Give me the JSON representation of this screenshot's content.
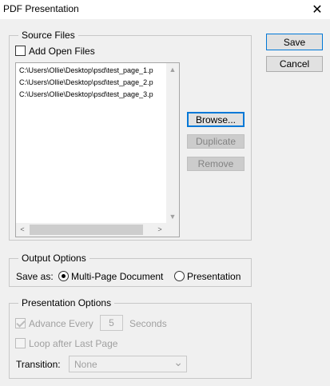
{
  "window": {
    "title": "PDF Presentation",
    "close_glyph": "✕"
  },
  "source_files": {
    "legend": "Source Files",
    "add_open_files_label": "Add Open Files",
    "files": [
      "C:\\Users\\Ollie\\Desktop\\psd\\test_page_1.p",
      "C:\\Users\\Ollie\\Desktop\\psd\\test_page_2.p",
      "C:\\Users\\Ollie\\Desktop\\psd\\test_page_3.p"
    ],
    "browse_label": "Browse...",
    "duplicate_label": "Duplicate",
    "remove_label": "Remove"
  },
  "buttons": {
    "save_label": "Save",
    "cancel_label": "Cancel"
  },
  "output_options": {
    "legend": "Output Options",
    "save_as_label": "Save as:",
    "multi_page_label": "Multi-Page Document",
    "presentation_label": "Presentation",
    "selected": "Multi-Page Document"
  },
  "presentation_options": {
    "legend": "Presentation Options",
    "advance_every_label": "Advance Every",
    "advance_seconds_value": "5",
    "seconds_label": "Seconds",
    "loop_label": "Loop after Last Page",
    "transition_label": "Transition:",
    "transition_value": "None"
  },
  "icons": {
    "scroll_up": "▲",
    "scroll_down": "▼",
    "scroll_left": "<",
    "scroll_right": ">",
    "dropdown": "⌄"
  },
  "colors": {
    "accent": "#0078d7",
    "disabled_text": "#a0a0a0"
  }
}
